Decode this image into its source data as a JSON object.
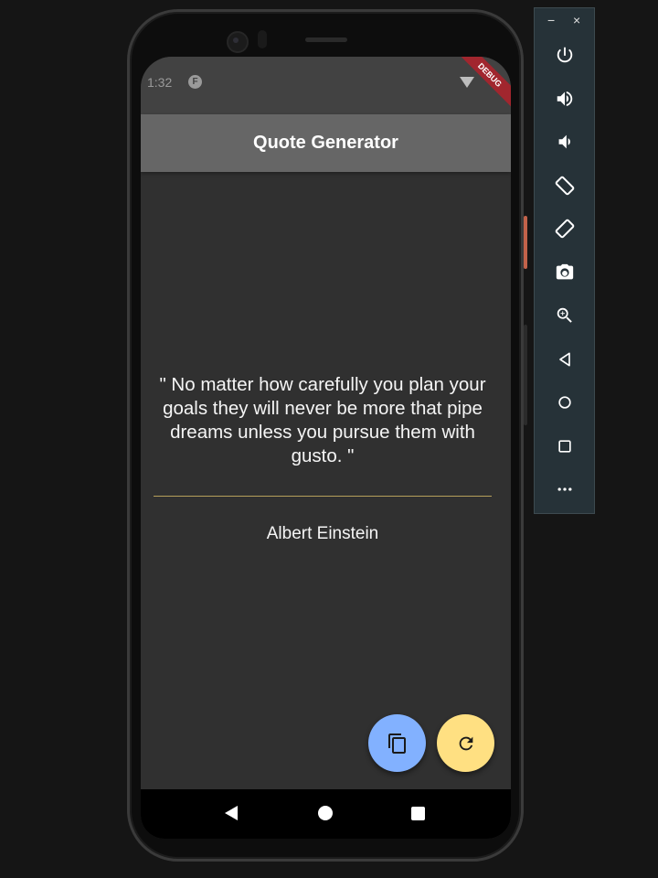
{
  "emulator": {
    "minimize_label": "−",
    "close_label": "×",
    "buttons": [
      {
        "icon": "power-icon"
      },
      {
        "icon": "volume-up-icon"
      },
      {
        "icon": "volume-down-icon"
      },
      {
        "icon": "rotate-left-icon"
      },
      {
        "icon": "rotate-right-icon"
      },
      {
        "icon": "camera-icon"
      },
      {
        "icon": "zoom-icon"
      },
      {
        "icon": "back-icon"
      },
      {
        "icon": "home-icon"
      },
      {
        "icon": "overview-icon"
      },
      {
        "icon": "more-icon"
      }
    ]
  },
  "status_bar": {
    "time": "1:32",
    "debug_label": "DEBUG"
  },
  "app_bar": {
    "title": "Quote Generator"
  },
  "quote": {
    "text": "\" No matter how carefully you plan your goals they will never be more that pipe dreams unless you pursue them with gusto. \"",
    "author": "Albert Einstein"
  },
  "fabs": {
    "copy_icon": "copy-icon",
    "refresh_icon": "refresh-icon",
    "copy_color": "#82b1ff",
    "refresh_color": "#ffe082"
  },
  "colors": {
    "background": "#303030",
    "app_bar": "#666666",
    "divider": "#b59f5a"
  }
}
